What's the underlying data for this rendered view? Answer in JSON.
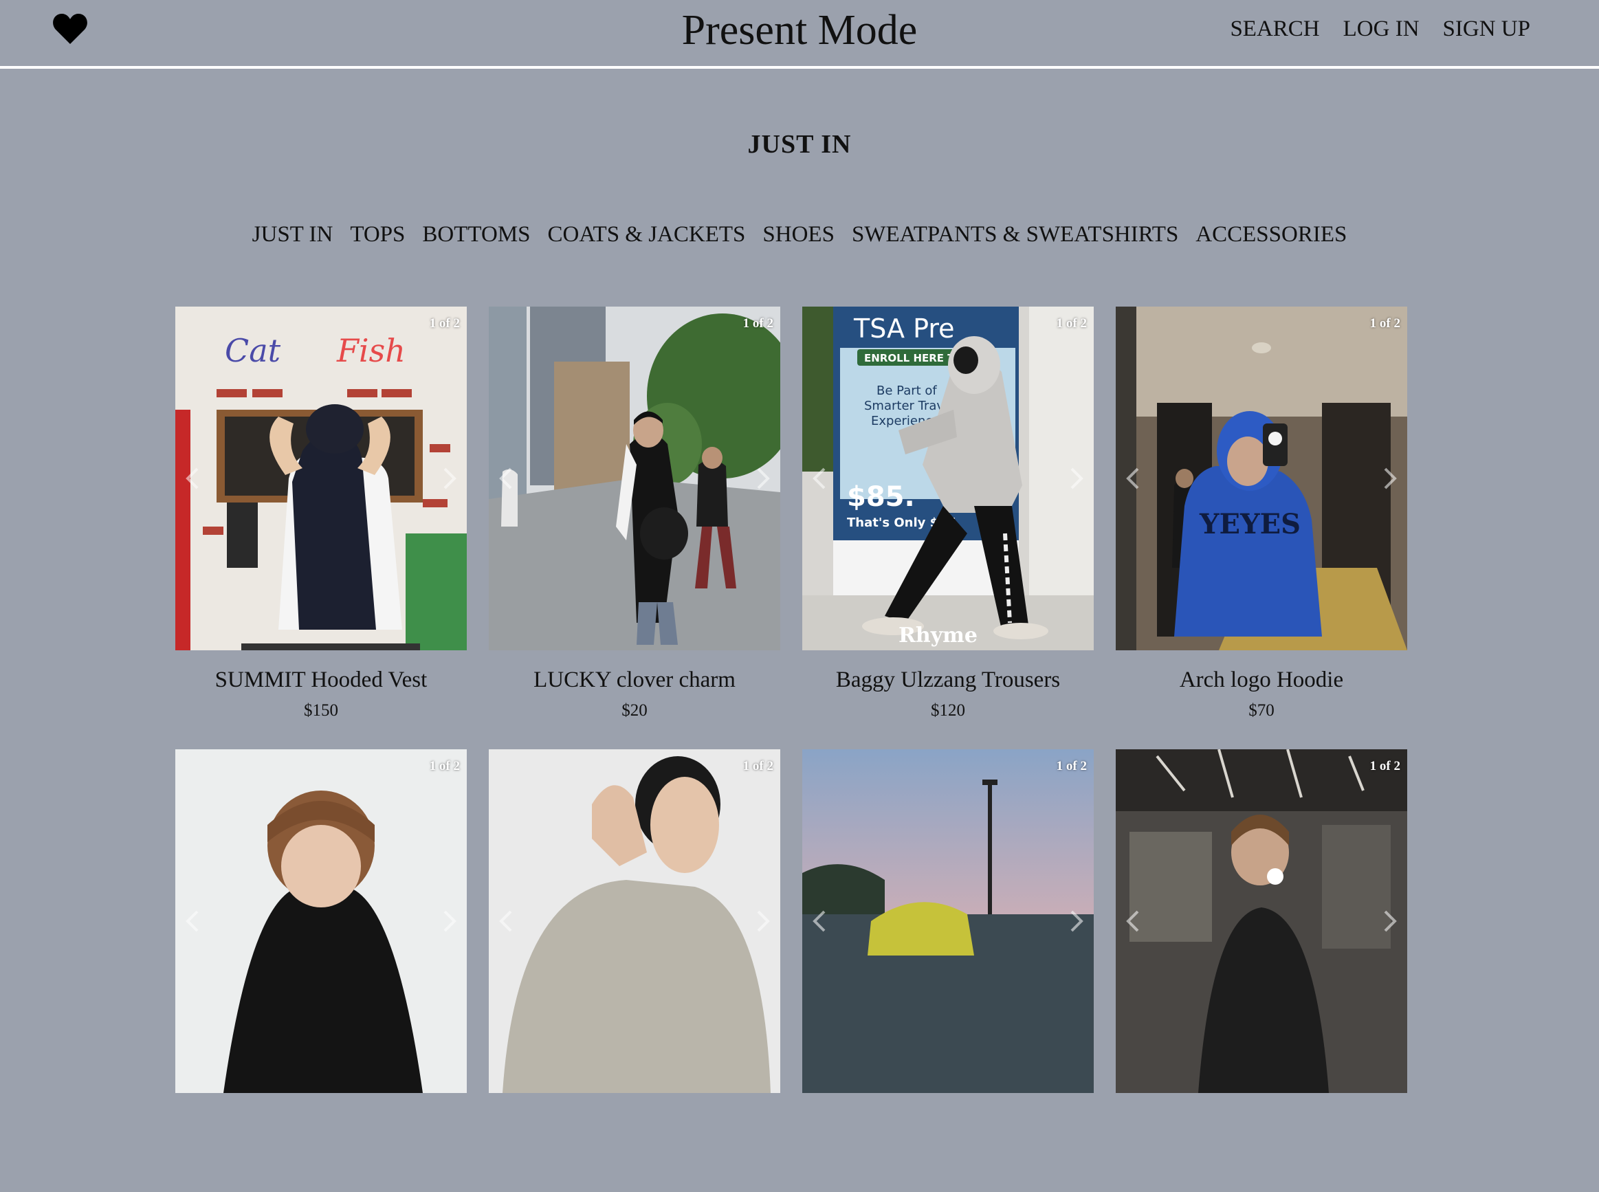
{
  "header": {
    "site_title": "Present Mode",
    "nav": {
      "search": "SEARCH",
      "login": "LOG IN",
      "signup": "SIGN UP"
    }
  },
  "section_title": "JUST IN",
  "categories": [
    "JUST IN",
    "TOPS",
    "BOTTOMS",
    "COATS & JACKETS",
    "SHOES",
    "SWEATPANTS & SWEATSHIRTS",
    "ACCESSORIES"
  ],
  "products": [
    {
      "name": "SUMMIT Hooded Vest",
      "price": "$150",
      "counter": "1 of 2",
      "sign_left": "Cat",
      "sign_right": "Fish"
    },
    {
      "name": "LUCKY clover charm",
      "price": "$20",
      "counter": "1 of 2"
    },
    {
      "name": "Baggy Ulzzang Trousers",
      "price": "$120",
      "counter": "1 of 2",
      "banner_title": "TSA Pre",
      "banner_enroll": "ENROLL HERE TODAY",
      "banner_line1": "Be Part of",
      "banner_line2": "Smarter Travel",
      "banner_line3": "Experience",
      "banner_price": "$85.",
      "banner_only": "That's Only $17",
      "watermark": "Rhyme"
    },
    {
      "name": "Arch logo Hoodie",
      "price": "$70",
      "counter": "1 of 2",
      "hoodie_text": "YEYES"
    },
    {
      "counter": "1 of 2"
    },
    {
      "counter": "1 of 2"
    },
    {
      "counter": "1 of 2"
    },
    {
      "counter": "1 of 2"
    }
  ],
  "colors": {
    "background": "#9ba1ad",
    "header_rule": "#ffffff",
    "text": "#111111"
  },
  "icons": {
    "wishlist": "heart-icon",
    "carousel_prev": "chevron-left-icon",
    "carousel_next": "chevron-right-icon"
  }
}
